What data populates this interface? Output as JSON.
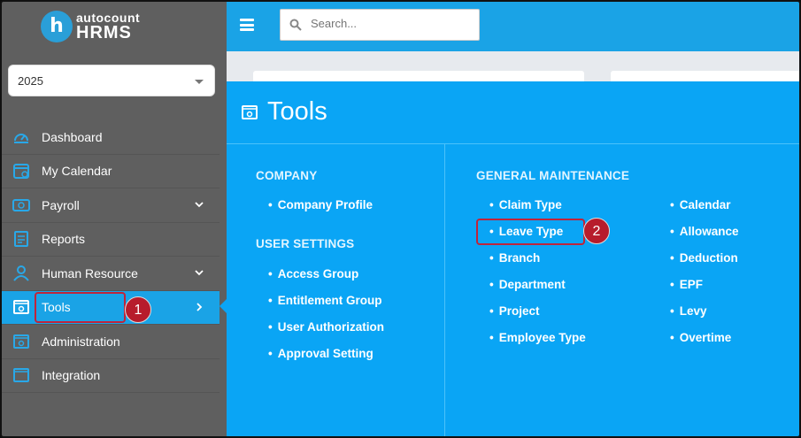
{
  "app": {
    "brand_top": "autocount",
    "brand_bottom": "HRMS",
    "logo_letter": "h"
  },
  "year_selector": {
    "value": "2025"
  },
  "search": {
    "placeholder": "Search..."
  },
  "sidebar": {
    "items": [
      {
        "label": "Dashboard",
        "icon": "dashboard-icon"
      },
      {
        "label": "My Calendar",
        "icon": "calendar-icon"
      },
      {
        "label": "Payroll",
        "icon": "payroll-icon"
      },
      {
        "label": "Reports",
        "icon": "reports-icon"
      },
      {
        "label": "Human Resource",
        "icon": "human-resource-icon"
      },
      {
        "label": "Tools",
        "icon": "tools-icon"
      },
      {
        "label": "Administration",
        "icon": "administration-icon"
      },
      {
        "label": "Integration",
        "icon": "integration-icon"
      }
    ]
  },
  "panel": {
    "title": "Tools",
    "company": {
      "heading": "COMPANY",
      "links": [
        "Company Profile"
      ]
    },
    "user_settings": {
      "heading": "USER SETTINGS",
      "links": [
        "Access Group",
        "Entitlement Group",
        "User Authorization",
        "Approval Setting"
      ]
    },
    "general_maintenance": {
      "heading": "GENERAL MAINTENANCE",
      "col1": [
        "Claim Type",
        "Leave Type",
        "Branch",
        "Department",
        "Project",
        "Employee Type"
      ],
      "col2": [
        "Calendar",
        "Allowance",
        "Deduction",
        "EPF",
        "Levy",
        "Overtime"
      ]
    }
  },
  "annotations": {
    "step1": "1",
    "step2": "2"
  },
  "colors": {
    "accent": "#1aa3e6",
    "panel": "#0aa5f5",
    "sidebar": "#5f5f5f",
    "highlight": "#c0243a"
  }
}
